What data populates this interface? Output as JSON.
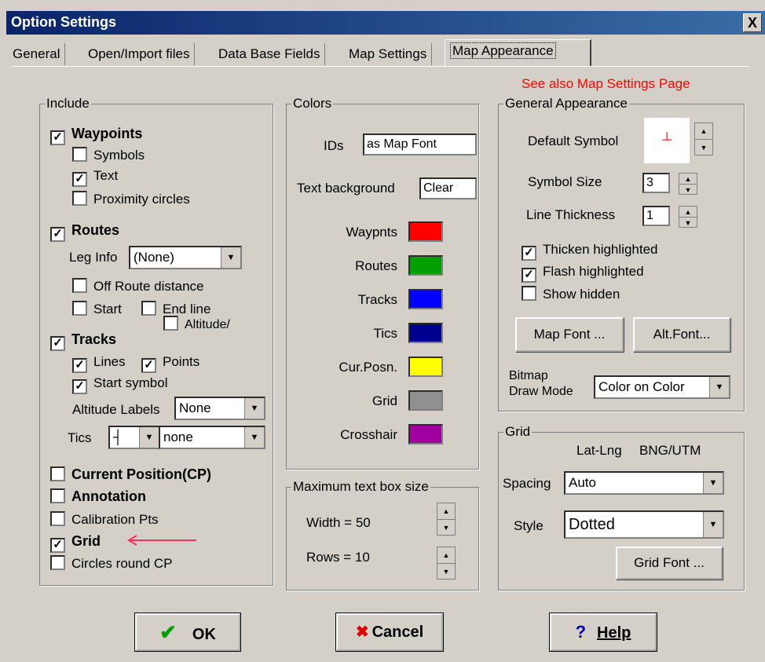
{
  "window": {
    "title": "Option Settings",
    "close": "X"
  },
  "tabs": [
    "General",
    "Open/Import files",
    "Data Base Fields",
    "Map Settings",
    "Map Appearance"
  ],
  "see_also": "See also Map Settings Page",
  "include": {
    "title": "Include",
    "waypoints": "Waypoints",
    "symbols": "Symbols",
    "text": "Text",
    "proximity": "Proximity circles",
    "routes": "Routes",
    "leg_info_label": "Leg Info",
    "leg_info_value": "(None)",
    "off_route": "Off Route distance",
    "start": "Start",
    "end_line": "End line",
    "altitude": "Altitude/",
    "tracks": "Tracks",
    "lines": "Lines",
    "points": "Points",
    "start_symbol": "Start symbol",
    "alt_labels_label": "Altitude Labels",
    "alt_labels_value": "None",
    "tics_label": "Tics",
    "tics_symbol": "┤",
    "tics_value": "none",
    "current_position": "Current Position(CP)",
    "annotation": "Annotation",
    "calibration": "Calibration Pts",
    "grid": "Grid",
    "circles_cp": "Circles round CP",
    "check": "✓"
  },
  "colors": {
    "title": "Colors",
    "ids_label": "IDs",
    "ids_value": "as Map Font",
    "text_bg_label": "Text background",
    "text_bg_value": "Clear",
    "items": [
      {
        "label": "Waypnts",
        "color": "#ff0000"
      },
      {
        "label": "Routes",
        "color": "#00a000"
      },
      {
        "label": "Tracks",
        "color": "#0000ff"
      },
      {
        "label": "Tics",
        "color": "#000090"
      },
      {
        "label": "Cur.Posn.",
        "color": "#ffff00"
      },
      {
        "label": "Grid",
        "color": "#909090"
      },
      {
        "label": "Crosshair",
        "color": "#a000a0"
      }
    ]
  },
  "maxtext": {
    "title": "Maximum text box size",
    "width": "Width = 50",
    "rows": "Rows  = 10"
  },
  "general": {
    "title": "General Appearance",
    "default_symbol": "Default Symbol",
    "symbol_glyph": "┴",
    "symbol_size_label": "Symbol Size",
    "symbol_size_value": "3",
    "line_thickness_label": "Line Thickness",
    "line_thickness_value": "1",
    "thicken": "Thicken highlighted",
    "flash": "Flash highlighted",
    "show_hidden": "Show hidden",
    "map_font_btn": "Map Font ...",
    "alt_font_btn": "Alt.Font...",
    "bitmap_label1": "Bitmap",
    "bitmap_label2": "Draw Mode",
    "bitmap_value": "Color on Color"
  },
  "grid": {
    "title": "Grid",
    "latlng": "Lat-Lng",
    "bngutm": "BNG/UTM",
    "spacing_label": "Spacing",
    "spacing_value": "Auto",
    "style_label": "Style",
    "style_value": "Dotted",
    "grid_font_btn": "Grid Font ..."
  },
  "buttons": {
    "ok": "OK",
    "ok_icon": "✔",
    "cancel": "Cancel",
    "cancel_icon": "✖",
    "help": "Help",
    "help_icon": "?"
  },
  "colors_accent": {
    "see_also": "#ff0000",
    "arrow": "#ff3060",
    "title_bar": "#0a246a"
  }
}
